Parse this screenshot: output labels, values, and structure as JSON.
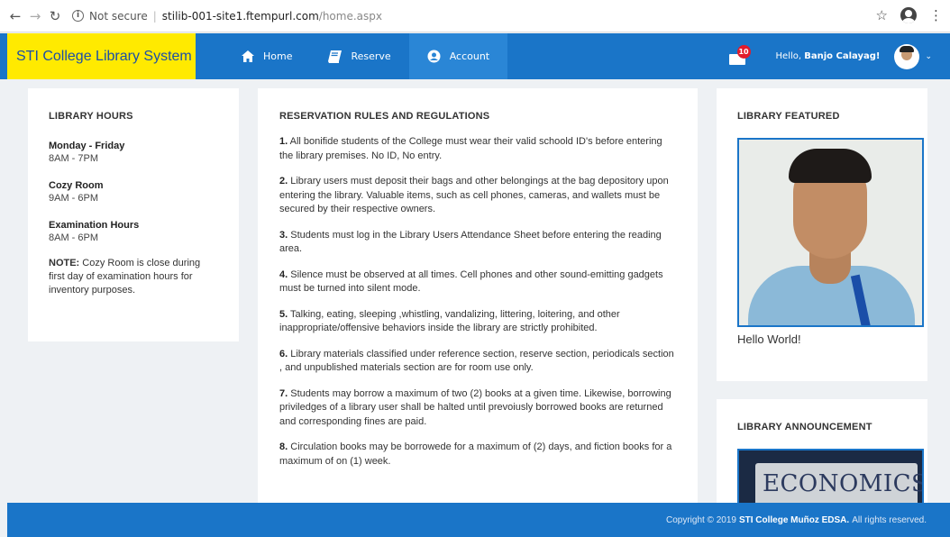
{
  "browser": {
    "security_label": "Not secure",
    "url_host": "stilib-001-site1.ftempurl.com",
    "url_path": "/home.aspx"
  },
  "header": {
    "brand": "STI College Library System",
    "menu": [
      {
        "label": "Home",
        "icon": "home-icon"
      },
      {
        "label": "Reserve",
        "icon": "book-icon"
      },
      {
        "label": "Account",
        "icon": "user-circle-icon"
      }
    ],
    "mail_badge": "10",
    "greeting": "Hello,",
    "user_name": "Banjo Calayag!"
  },
  "library_hours": {
    "title": "LIBRARY HOURS",
    "blocks": [
      {
        "label": "Monday - Friday",
        "value": "8AM - 7PM"
      },
      {
        "label": "Cozy Room",
        "value": "9AM - 6PM"
      },
      {
        "label": "Examination Hours",
        "value": "8AM - 6PM"
      }
    ],
    "note_label": "NOTE:",
    "note_text": " Cozy Room is close during first day of examination hours for inventory purposes."
  },
  "rules": {
    "title": "RESERVATION RULES AND REGULATIONS",
    "items": [
      {
        "num": "1.",
        "text": " All bonifide students of the College must wear their valid schoold ID's before entering the library premises. No ID, No entry."
      },
      {
        "num": "2.",
        "text": " Library users must deposit their bags and other belongings at the bag depository upon entering the library. Valuable items, such as cell phones, cameras, and wallets must be secured by their respective owners."
      },
      {
        "num": "3.",
        "text": " Students must log in the Library Users Attendance Sheet before entering the reading area."
      },
      {
        "num": "4.",
        "text": " Silence must be observed at all times. Cell phones and other sound-emitting gadgets must be turned into silent mode."
      },
      {
        "num": "5.",
        "text": " Talking, eating, sleeping ,whistling, vandalizing, littering, loitering, and other inappropriate/offensive behaviors inside the library are strictly prohibited."
      },
      {
        "num": "6.",
        "text": " Library materials classified under reference section, reserve section, periodicals section , and unpublished materials section are for room use only."
      },
      {
        "num": "7.",
        "text": " Students may borrow a maximum of two (2) books at a given time. Likewise, borrowing priviledges of a library user shall be halted until prevoiusly borrowed books are returned and corresponding fines are paid."
      },
      {
        "num": "8.",
        "text": " Circulation books may be borrowede for a maximum of (2) days, and fiction books for a maximum of on (1) week."
      }
    ]
  },
  "featured": {
    "title": "LIBRARY FEATURED",
    "caption": "Hello World!"
  },
  "announcement": {
    "title": "LIBRARY ANNOUNCEMENT",
    "image_text": "ECONOMICS"
  },
  "footer": {
    "prefix": "Copyright © 2019",
    "org": "STI College Muñoz EDSA.",
    "suffix": "All rights reserved."
  },
  "colors": {
    "primary": "#1a75c8",
    "brand_bg": "#ffea00",
    "badge": "#e21b2b"
  }
}
